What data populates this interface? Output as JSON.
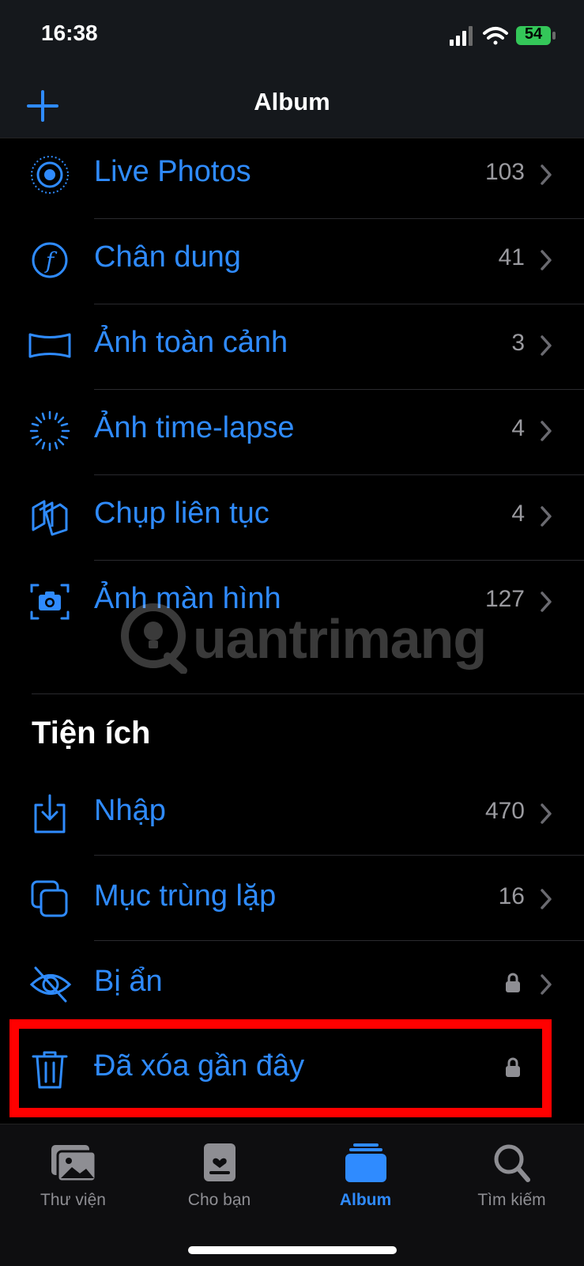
{
  "status": {
    "time": "16:38",
    "battery": "54"
  },
  "nav": {
    "title": "Album"
  },
  "media_types": [
    {
      "label": "Live Photos",
      "count": "103",
      "icon": "live-photos-icon"
    },
    {
      "label": "Chân dung",
      "count": "41",
      "icon": "portrait-icon"
    },
    {
      "label": "Ảnh toàn cảnh",
      "count": "3",
      "icon": "panorama-icon"
    },
    {
      "label": "Ảnh time-lapse",
      "count": "4",
      "icon": "time-lapse-icon"
    },
    {
      "label": "Chụp liên tục",
      "count": "4",
      "icon": "burst-icon"
    },
    {
      "label": "Ảnh màn hình",
      "count": "127",
      "icon": "screenshot-icon"
    }
  ],
  "utilities": {
    "title": "Tiện ích",
    "items": [
      {
        "label": "Nhập",
        "count": "470",
        "icon": "import-icon"
      },
      {
        "label": "Mục trùng lặp",
        "count": "16",
        "icon": "duplicates-icon"
      },
      {
        "label": "Bị ẩn",
        "locked": true,
        "icon": "hidden-eye-icon"
      },
      {
        "label": "Đã xóa gần đây",
        "locked": true,
        "icon": "trash-icon"
      }
    ]
  },
  "watermark": {
    "text": "uantrimang"
  },
  "tabs": [
    {
      "label": "Thư viện",
      "icon": "library-icon"
    },
    {
      "label": "Cho bạn",
      "icon": "for-you-icon"
    },
    {
      "label": "Album",
      "icon": "albums-icon",
      "active": true
    },
    {
      "label": "Tìm kiếm",
      "icon": "search-icon"
    }
  ],
  "colors": {
    "accent": "#2f8bff",
    "highlight": "#ff0000",
    "background": "#000000"
  }
}
